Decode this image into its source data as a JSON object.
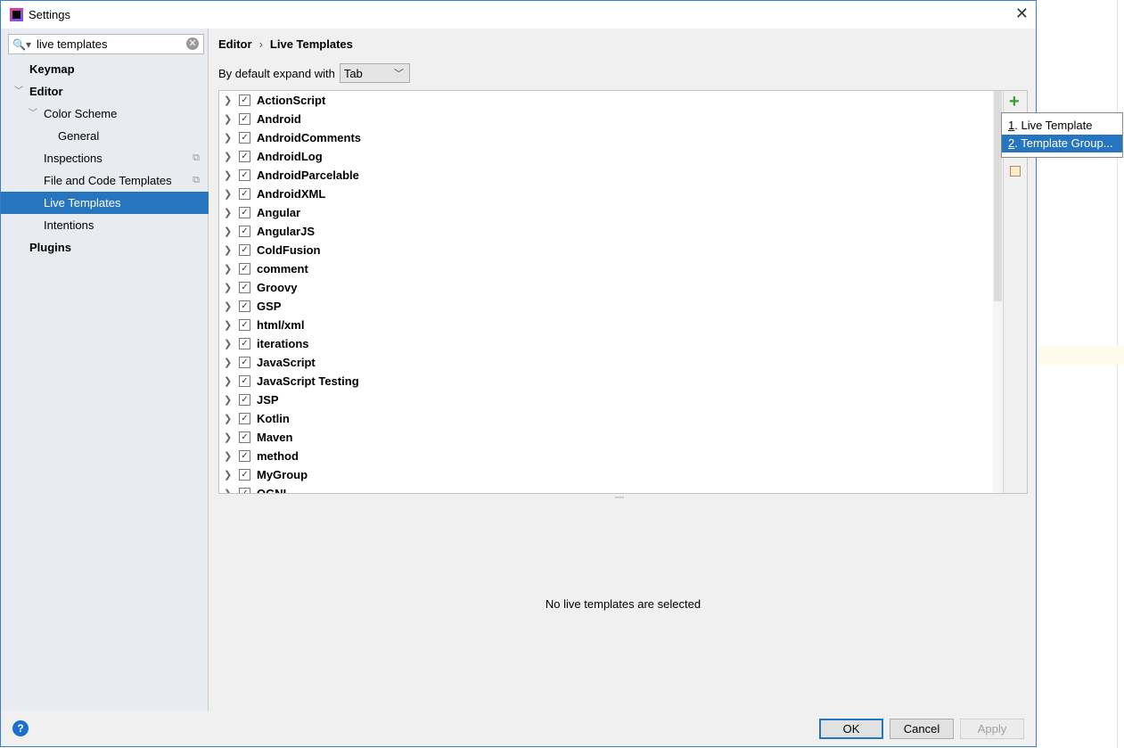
{
  "window": {
    "title": "Settings"
  },
  "search": {
    "value": "live templates"
  },
  "sidebar": {
    "items": [
      {
        "label": "Keymap",
        "bold": true,
        "level": 0
      },
      {
        "label": "Editor",
        "bold": true,
        "level": 0,
        "expanded": true
      },
      {
        "label": "Color Scheme",
        "level": 1,
        "expanded": true
      },
      {
        "label": "General",
        "level": 2
      },
      {
        "label": "Inspections",
        "level": 1,
        "copy_icon": true
      },
      {
        "label": "File and Code Templates",
        "level": 1,
        "copy_icon": true
      },
      {
        "label": "Live Templates",
        "level": 1,
        "selected": true
      },
      {
        "label": "Intentions",
        "level": 1
      },
      {
        "label": "Plugins",
        "bold": true,
        "level": 0
      }
    ]
  },
  "breadcrumb": {
    "parent": "Editor",
    "current": "Live Templates"
  },
  "expand": {
    "label": "By default expand with",
    "value": "Tab"
  },
  "groups": [
    "ActionScript",
    "Android",
    "AndroidComments",
    "AndroidLog",
    "AndroidParcelable",
    "AndroidXML",
    "Angular",
    "AngularJS",
    "ColdFusion",
    "comment",
    "Groovy",
    "GSP",
    "html/xml",
    "iterations",
    "JavaScript",
    "JavaScript Testing",
    "JSP",
    "Kotlin",
    "Maven",
    "method",
    "MyGroup",
    "OGNL"
  ],
  "empty_message": "No live templates are selected",
  "popup": {
    "items": [
      {
        "num": "1",
        "label": ". Live Template"
      },
      {
        "num": "2",
        "label": ". Template Group..."
      }
    ],
    "selected": 1
  },
  "footer": {
    "ok": "OK",
    "cancel": "Cancel",
    "apply": "Apply",
    "help": "?"
  },
  "colors": {
    "accent": "#2675bf",
    "add": "#3a9a3a"
  }
}
